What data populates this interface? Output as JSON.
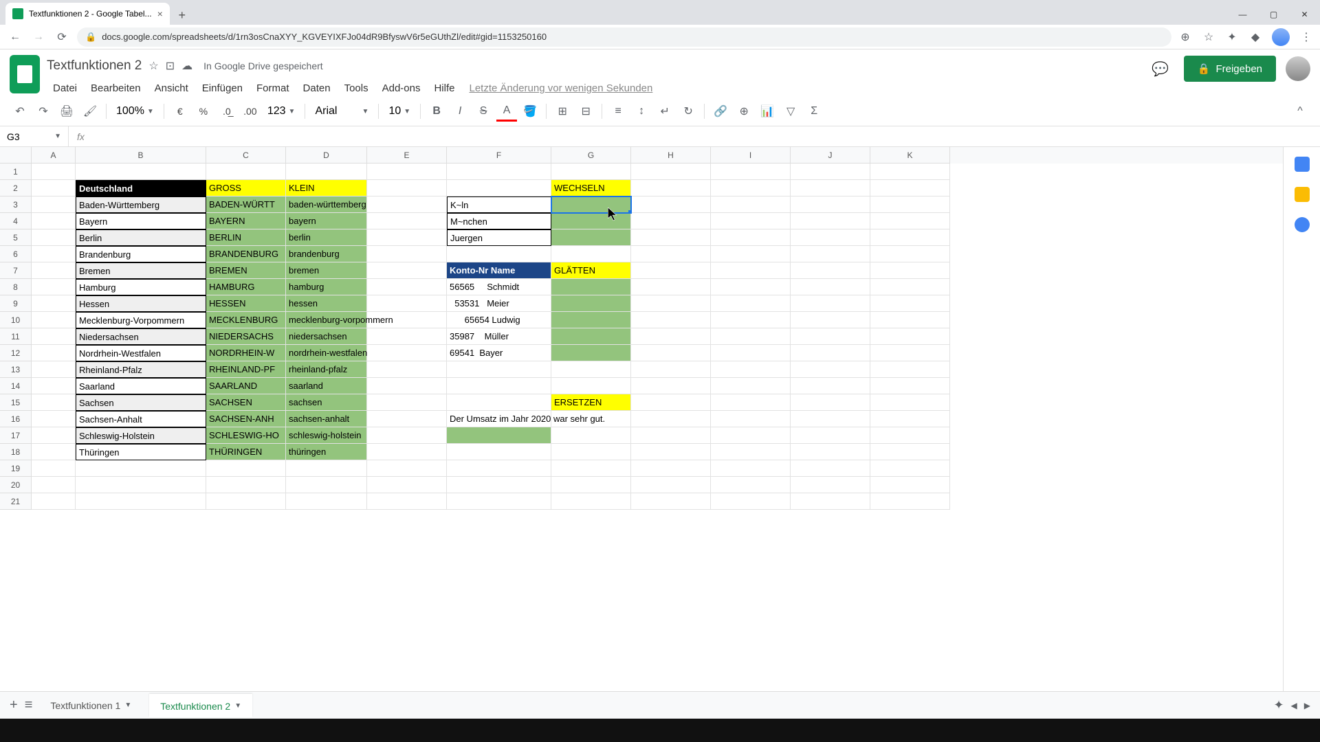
{
  "browser": {
    "tab_title": "Textfunktionen 2 - Google Tabel...",
    "url": "docs.google.com/spreadsheets/d/1rn3osCnaXYY_KGVEYIXFJo04dR9BfyswV6r5eGUthZl/edit#gid=1153250160"
  },
  "app": {
    "doc_title": "Textfunktionen 2",
    "saved_status": "In Google Drive gespeichert",
    "last_change": "Letzte Änderung vor wenigen Sekunden",
    "share_label": "Freigeben"
  },
  "menus": [
    "Datei",
    "Bearbeiten",
    "Ansicht",
    "Einfügen",
    "Format",
    "Daten",
    "Tools",
    "Add-ons",
    "Hilfe"
  ],
  "toolbar": {
    "zoom": "100%",
    "font": "Arial",
    "size": "10",
    "format_num": "123"
  },
  "formula": {
    "name_box": "G3",
    "fx": ""
  },
  "columns": [
    "A",
    "B",
    "C",
    "D",
    "E",
    "F",
    "G",
    "H",
    "I",
    "J",
    "K"
  ],
  "row_numbers": [
    "1",
    "2",
    "3",
    "4",
    "5",
    "6",
    "7",
    "8",
    "9",
    "10",
    "11",
    "12",
    "13",
    "14",
    "15",
    "16",
    "17",
    "18",
    "19",
    "20",
    "21"
  ],
  "headers2": {
    "B": "Deutschland",
    "C": "GROSS",
    "D": "KLEIN",
    "G": "WECHSELN"
  },
  "states": [
    {
      "b": "Baden-Württemberg",
      "c": "BADEN-WÜRTT",
      "d": "baden-württemberg"
    },
    {
      "b": "Bayern",
      "c": "BAYERN",
      "d": "bayern"
    },
    {
      "b": "Berlin",
      "c": "BERLIN",
      "d": "berlin"
    },
    {
      "b": "Brandenburg",
      "c": "BRANDENBURG",
      "d": "brandenburg"
    },
    {
      "b": "Bremen",
      "c": "BREMEN",
      "d": "bremen"
    },
    {
      "b": "Hamburg",
      "c": "HAMBURG",
      "d": "hamburg"
    },
    {
      "b": "Hessen",
      "c": "HESSEN",
      "d": "hessen"
    },
    {
      "b": "Mecklenburg-Vorpommern",
      "c": "MECKLENBURG",
      "d": "mecklenburg-vorpommern"
    },
    {
      "b": "Niedersachsen",
      "c": "NIEDERSACHS",
      "d": "niedersachsen"
    },
    {
      "b": "Nordrhein-Westfalen",
      "c": "NORDRHEIN-W",
      "d": "nordrhein-westfalen"
    },
    {
      "b": "Rheinland-Pfalz",
      "c": "RHEINLAND-PF",
      "d": "rheinland-pfalz"
    },
    {
      "b": "Saarland",
      "c": "SAARLAND",
      "d": "saarland"
    },
    {
      "b": "Sachsen",
      "c": "SACHSEN",
      "d": "sachsen"
    },
    {
      "b": "Sachsen-Anhalt",
      "c": "SACHSEN-ANH",
      "d": "sachsen-anhalt"
    },
    {
      "b": "Schleswig-Holstein",
      "c": "SCHLESWIG-HO",
      "d": "schleswig-holstein"
    },
    {
      "b": "Thüringen",
      "c": "THÜRINGEN",
      "d": "thüringen"
    }
  ],
  "wechseln_f": [
    "K~ln",
    "M~nchen",
    "Juergen"
  ],
  "konto_header": "Konto-Nr Name",
  "glatten": "GLÄTTEN",
  "konto_rows": [
    "56565     Schmidt",
    "  53531   Meier",
    "      65654 Ludwig",
    "35987    Müller",
    "69541  Bayer"
  ],
  "ersetzen": "ERSETZEN",
  "umsatz": "Der Umsatz im Jahr 2020 war sehr gut.",
  "sheets": {
    "tab1": "Textfunktionen 1",
    "tab2": "Textfunktionen 2"
  }
}
